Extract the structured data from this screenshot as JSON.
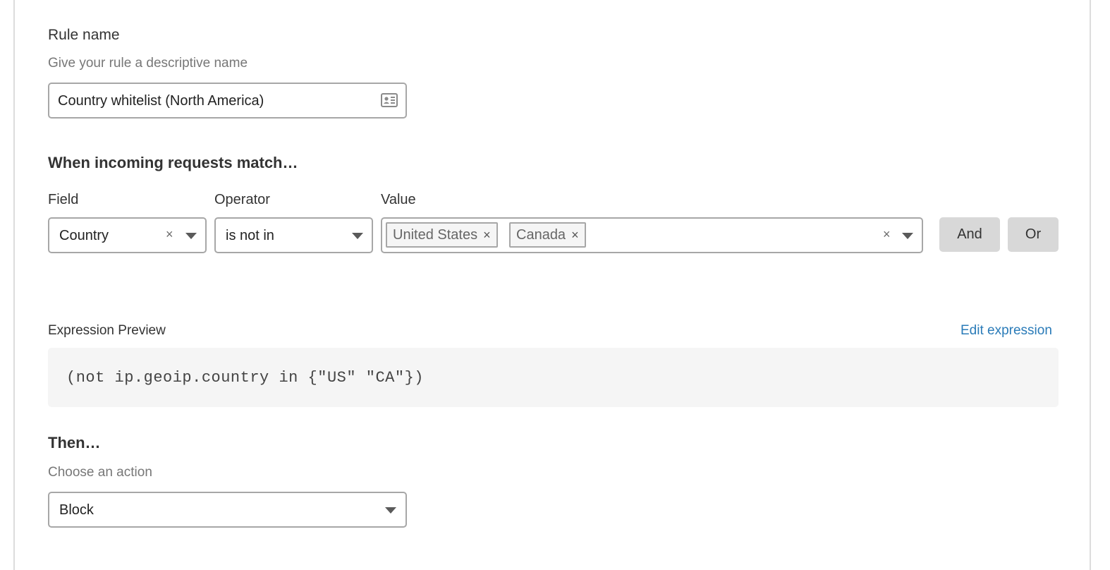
{
  "rule_name": {
    "label": "Rule name",
    "help": "Give your rule a descriptive name",
    "value": "Country whitelist (North America)",
    "icon": "contact-card-icon"
  },
  "match": {
    "heading": "When incoming requests match…",
    "field_label": "Field",
    "operator_label": "Operator",
    "value_label": "Value",
    "field_value": "Country",
    "operator_value": "is not in",
    "value_tags": [
      "United States",
      "Canada"
    ],
    "tag_remove_symbol": "×",
    "clear_symbol": "×",
    "and_button": "And",
    "or_button": "Or"
  },
  "expression": {
    "label": "Expression Preview",
    "edit_link": "Edit expression",
    "code": "(not ip.geoip.country in {\"US\" \"CA\"})"
  },
  "then": {
    "heading": "Then…",
    "help": "Choose an action",
    "action_value": "Block"
  },
  "colors": {
    "link": "#2a7bb8",
    "button_bg": "#d8d8d8",
    "border": "#a7a7a7",
    "code_bg": "#f5f5f5"
  }
}
